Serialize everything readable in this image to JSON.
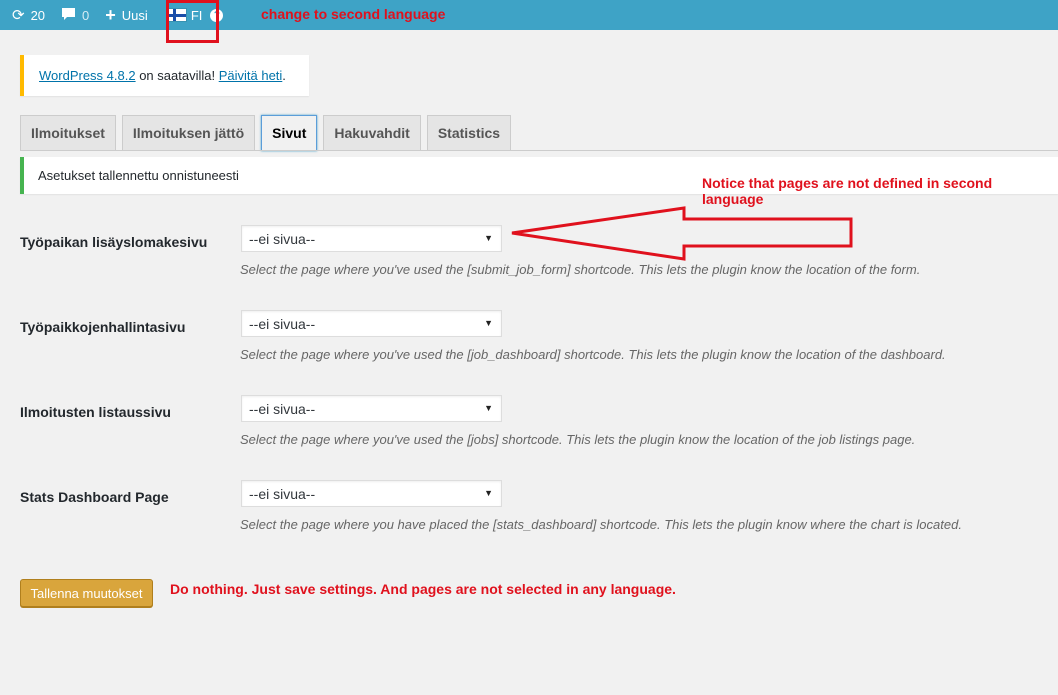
{
  "adminbar": {
    "updates_icon": "refresh-icon",
    "updates_count": "20",
    "comments_icon": "comment-bubble-icon",
    "comments_count": "0",
    "new_label": "Uusi",
    "language_flag": "finland-flag-icon",
    "language_code": "FI",
    "help_icon": "question-mark-icon",
    "background_color": "#3ea3c6"
  },
  "annotations": {
    "language_note": "change to second language",
    "pages_note": "Notice that pages are not defined in second language",
    "save_note": "Do nothing. Just save settings. And pages are not selected in any language.",
    "color": "#e0111d"
  },
  "update_notice": {
    "link_text": "WordPress 4.8.2",
    "middle_text": " on saatavilla! ",
    "action_text": "Päivitä heti",
    "tail_text": "."
  },
  "tabs": [
    {
      "label": "Ilmoitukset",
      "active": false
    },
    {
      "label": "Ilmoituksen jättö",
      "active": false
    },
    {
      "label": "Sivut",
      "active": true
    },
    {
      "label": "Hakuvahdit",
      "active": false
    },
    {
      "label": "Statistics",
      "active": false
    }
  ],
  "success_notice": "Asetukset tallennettu onnistuneesti",
  "fields": [
    {
      "label": "Työpaikan lisäyslomakesivu",
      "selected": "--ei sivua--",
      "description": "Select the page where you've used the [submit_job_form] shortcode. This lets the plugin know the location of the form."
    },
    {
      "label": "Työpaikkojenhallintasivu",
      "selected": "--ei sivua--",
      "description": "Select the page where you've used the [job_dashboard] shortcode. This lets the plugin know the location of the dashboard."
    },
    {
      "label": "Ilmoitusten listaussivu",
      "selected": "--ei sivua--",
      "description": "Select the page where you've used the [jobs] shortcode. This lets the plugin know the location of the job listings page."
    },
    {
      "label": "Stats Dashboard Page",
      "selected": "--ei sivua--",
      "description": "Select the page where you have placed the [stats_dashboard] shortcode. This lets the plugin know where the chart is located."
    }
  ],
  "save_button": "Tallenna muutokset"
}
